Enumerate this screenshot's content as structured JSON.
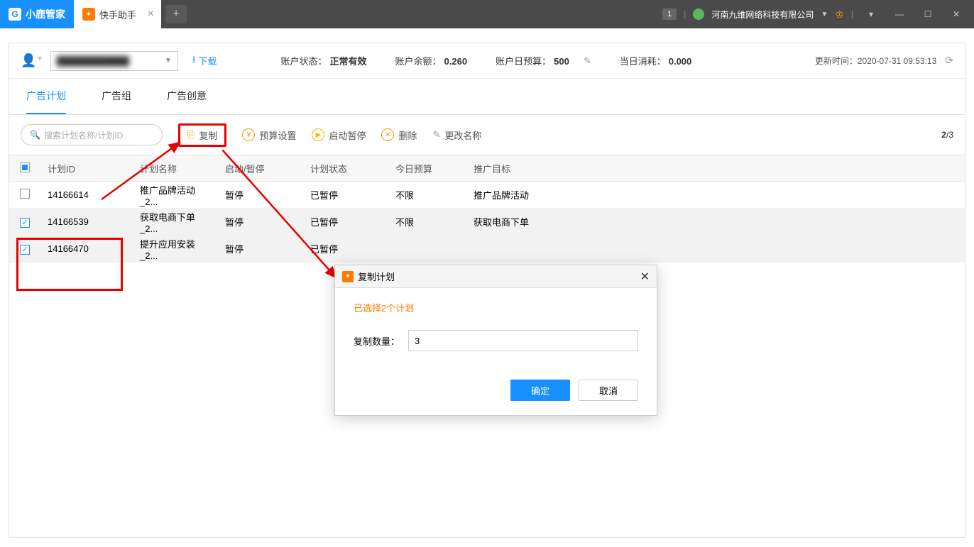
{
  "title_bar": {
    "app_name": "小鹿管家",
    "tab_label": "快手助手",
    "badge": "1",
    "org_name": "河南九维网络科技有限公司"
  },
  "info_bar": {
    "account_text": "████████████",
    "download": "下载",
    "status_label": "账户状态：",
    "status_value": "正常有效",
    "balance_label": "账户余额：",
    "balance_value": "0.260",
    "budget_label": "账户日预算：",
    "budget_value": "500",
    "spend_label": "当日消耗：",
    "spend_value": "0.000",
    "update_label": "更新时间：",
    "update_value": "2020-07-31 09:53:13"
  },
  "tabs": {
    "t1": "广告计划",
    "t2": "广告组",
    "t3": "广告创意"
  },
  "toolbar": {
    "search_placeholder": "搜索计划名称/计划ID",
    "copy": "复制",
    "budget": "预算设置",
    "startstop": "启动暂停",
    "delete": "删除",
    "rename": "更改名称",
    "pager_current": "2",
    "pager_total": "/3"
  },
  "table": {
    "headers": {
      "id": "计划ID",
      "name": "计划名称",
      "start": "启动/暂停",
      "state": "计划状态",
      "budget": "今日预算",
      "target": "推广目标"
    },
    "rows": [
      {
        "checked": false,
        "id": "14166614",
        "name": "推广品牌活动_2...",
        "start": "暂停",
        "state": "已暂停",
        "budget": "不限",
        "target": "推广品牌活动"
      },
      {
        "checked": true,
        "id": "14166539",
        "name": "获取电商下单_2...",
        "start": "暂停",
        "state": "已暂停",
        "budget": "不限",
        "target": "获取电商下单"
      },
      {
        "checked": true,
        "id": "14166470",
        "name": "提升应用安装_2...",
        "start": "暂停",
        "state": "已暂停",
        "budget": "",
        "target": ""
      }
    ]
  },
  "dialog": {
    "title": "复制计划",
    "selected_text": "已选择2个计划",
    "qty_label": "复制数量：",
    "qty_value": "3",
    "ok": "确定",
    "cancel": "取消"
  }
}
